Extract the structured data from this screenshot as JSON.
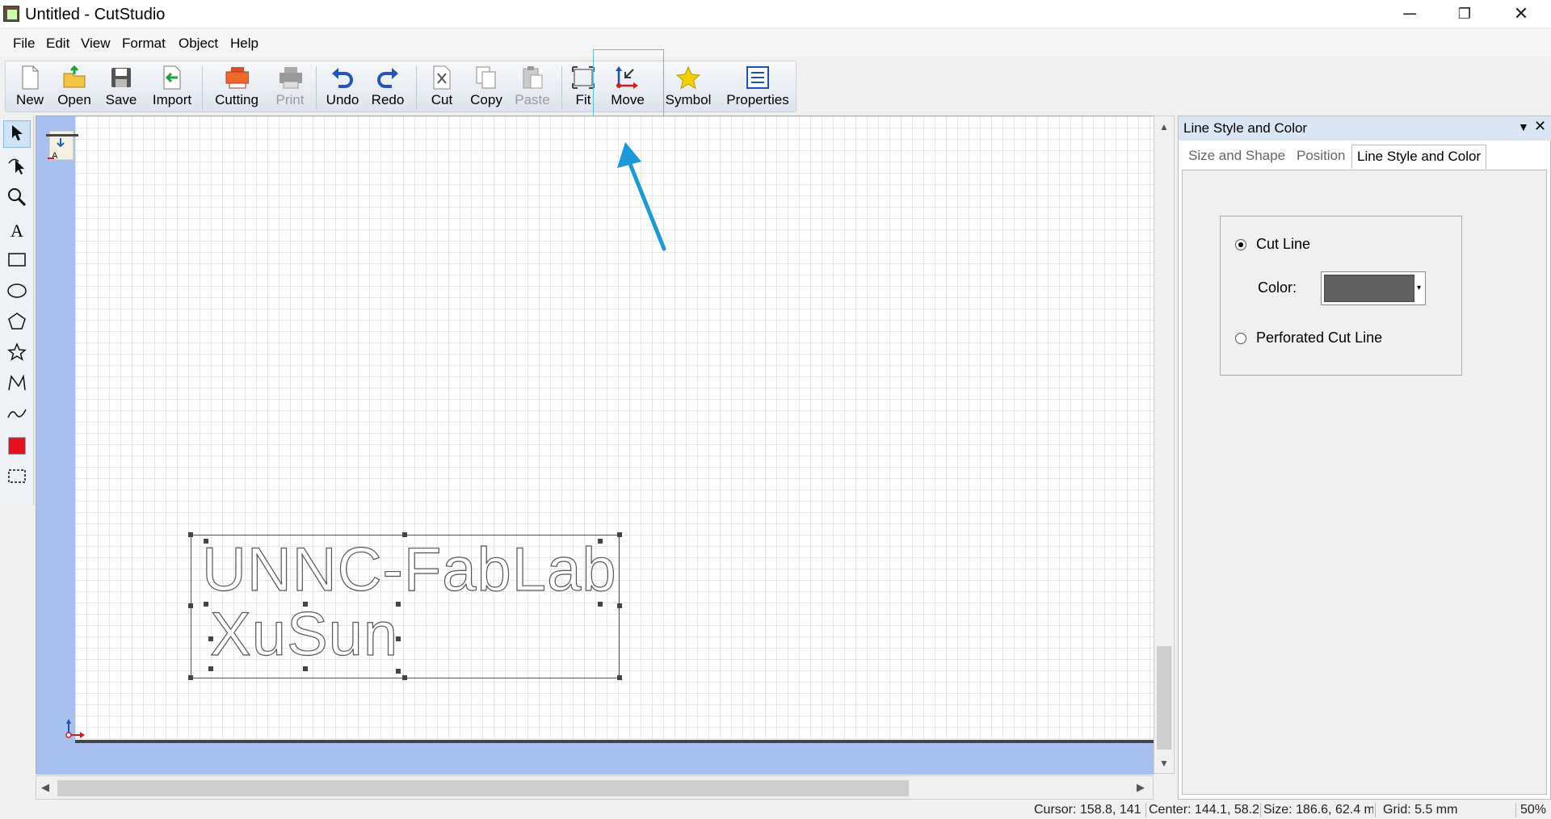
{
  "window": {
    "title": "Untitled - CutStudio",
    "minimize": "─",
    "restore": "❐",
    "close": "✕"
  },
  "menu": [
    {
      "label": "File"
    },
    {
      "label": "Edit"
    },
    {
      "label": "View"
    },
    {
      "label": "Format"
    },
    {
      "label": "Object"
    },
    {
      "label": "Help"
    }
  ],
  "toolbar": {
    "new": "New",
    "open": "Open",
    "save": "Save",
    "import": "Import",
    "cutting": "Cutting",
    "print": "Print",
    "undo": "Undo",
    "redo": "Redo",
    "cut": "Cut",
    "copy": "Copy",
    "paste": "Paste",
    "fit": "Fit",
    "move": "Move",
    "symbol": "Symbol",
    "properties": "Properties"
  },
  "canvas": {
    "line1": "UNNC-FabLab",
    "line2": "XuSun"
  },
  "panel": {
    "title": "Line Style and Color",
    "tabs": [
      "Size and Shape",
      "Position",
      "Line Style and Color"
    ],
    "active_tab": "Line Style and Color",
    "cut_line": "Cut Line",
    "color_label": "Color:",
    "color_value": "#616161",
    "perforated": "Perforated Cut Line",
    "selected_option": "Cut Line"
  },
  "status": {
    "cursor": "Cursor: 158.8, 141",
    "center": "Center: 144.1, 58.2",
    "size": "Size: 186.6, 62.4 m",
    "grid": "Grid: 5.5 mm",
    "zoom": "50%"
  },
  "colors": {
    "accent": "#1a9ad8",
    "canvas_margin": "#a6c0f0",
    "fill_tool": "#e8101e"
  }
}
